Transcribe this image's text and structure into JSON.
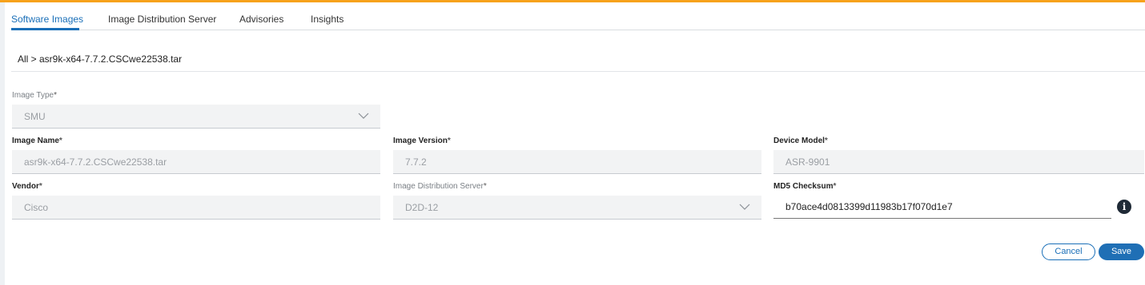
{
  "tabs": [
    {
      "label": "Software Images",
      "active": true
    },
    {
      "label": "Image Distribution Server",
      "active": false
    },
    {
      "label": "Advisories",
      "active": false
    },
    {
      "label": "Insights",
      "active": false
    }
  ],
  "breadcrumb": "All > asr9k-x64-7.7.2.CSCwe22538.tar",
  "form": {
    "image_type": {
      "label": "Image Type",
      "required": "*",
      "value": "SMU"
    },
    "image_name": {
      "label": "Image Name",
      "required": "*",
      "value": "asr9k-x64-7.7.2.CSCwe22538.tar"
    },
    "image_version": {
      "label": "Image Version",
      "required": "*",
      "value": "7.7.2"
    },
    "device_model": {
      "label": "Device Model",
      "required": "*",
      "value": "ASR-9901"
    },
    "vendor": {
      "label": "Vendor",
      "required": "*",
      "value": "Cisco"
    },
    "image_distribution_server": {
      "label": "Image Distribution Server",
      "required": "*",
      "value": "D2D-12"
    },
    "md5_checksum": {
      "label": "MD5 Checksum",
      "required": "*",
      "value": "b70ace4d0813399d11983b17f070d1e7"
    }
  },
  "icons": {
    "info": "info-icon",
    "chevron": "chevron-down-icon"
  },
  "actions": {
    "cancel_label": "Cancel",
    "save_label": "Save"
  },
  "colors": {
    "accent": "#f7a21b",
    "primary": "#1a6fb8",
    "save_bg": "#1f6fb5"
  }
}
